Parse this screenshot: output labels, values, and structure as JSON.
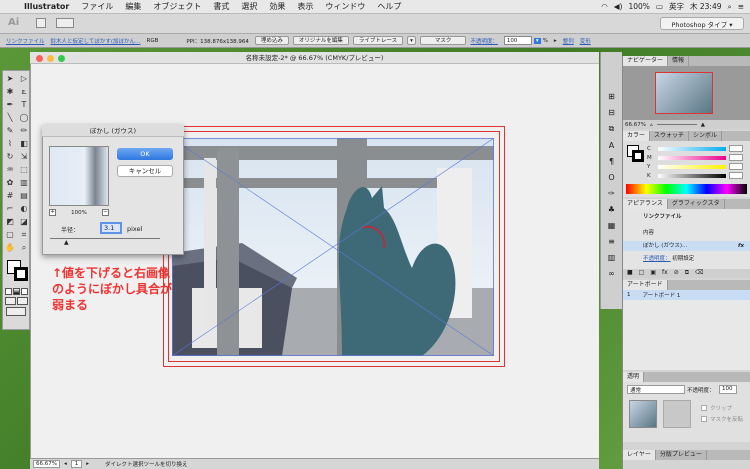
{
  "menubar": {
    "app": "Illustrator",
    "items": [
      "ファイル",
      "編集",
      "オブジェクト",
      "書式",
      "選択",
      "効果",
      "表示",
      "ウィンドウ",
      "ヘルプ"
    ],
    "battery": "100%",
    "input_mode": "英字",
    "clock": "木 23:49"
  },
  "appbar": {
    "logo": "Ai",
    "workspace": "Photoshop タイプ ▾"
  },
  "controlbar": {
    "linked_file": "リンクファイル",
    "file_name": "鈴木人と仮定してぼかす(加ぼかん…",
    "color_mode": "RGB",
    "ppi": "PPI：138.876x138.964",
    "embed_btn": "埋め込み",
    "edit_original_btn": "オリジナルを編集",
    "live_trace_btn": "ライブトレース",
    "mask_btn": "マスク",
    "opacity_label": "不透明度：",
    "opacity_value": "100",
    "unit": "%",
    "link1": "整列",
    "link2": "変形"
  },
  "document": {
    "title": "名称未設定-2* @ 66.67% (CMYK/プレビュー)"
  },
  "dialog": {
    "title": "ぼかし (ガウス)",
    "ok": "OK",
    "cancel": "キャンセル",
    "zoom": "100%",
    "radius_label": "半径：",
    "radius_value": "3.1",
    "radius_unit": "pixel"
  },
  "annotation": "↑値を下げると右画像のようにぼかし具合が弱まる",
  "panels": {
    "navigator_tab": "ナビゲーター",
    "info_tab": "情報",
    "nav_zoom": "66.67%",
    "color_tab": "カラー",
    "swatch_tab": "スウォッチ",
    "symbol_tab": "シンボル",
    "color_channels": [
      "C",
      "M",
      "Y",
      "K"
    ],
    "channel_colors": [
      "#00aeef",
      "#ec008c",
      "#fff200",
      "#000000"
    ],
    "appearance_tab": "アピアランス",
    "graphic_style_tab": "グラフィックスタ",
    "appearance_title": "リンクファイル",
    "appearance_content": "内容",
    "appearance_effect": "ぼかし (ガウス)...",
    "appearance_opacity": "不透明度：",
    "appearance_opacity_value": "初期設定",
    "artboard_tab": "アートボード",
    "artboard_row_index": "1",
    "artboard_row_name": "アートボード 1",
    "transparency_tab": "透明",
    "blend_mode": "通常",
    "transparency_opacity_label": "不透明度：",
    "transparency_opacity_value": "100",
    "clip_label": "クリップ",
    "invert_mask_label": "マスクを反転",
    "layer_tab": "レイヤー",
    "separation_tab": "分版プレビュー"
  },
  "statusbar": {
    "zoom": "66.67%",
    "page": "1",
    "status": "ダイレクト選択ツールを切り換え"
  }
}
